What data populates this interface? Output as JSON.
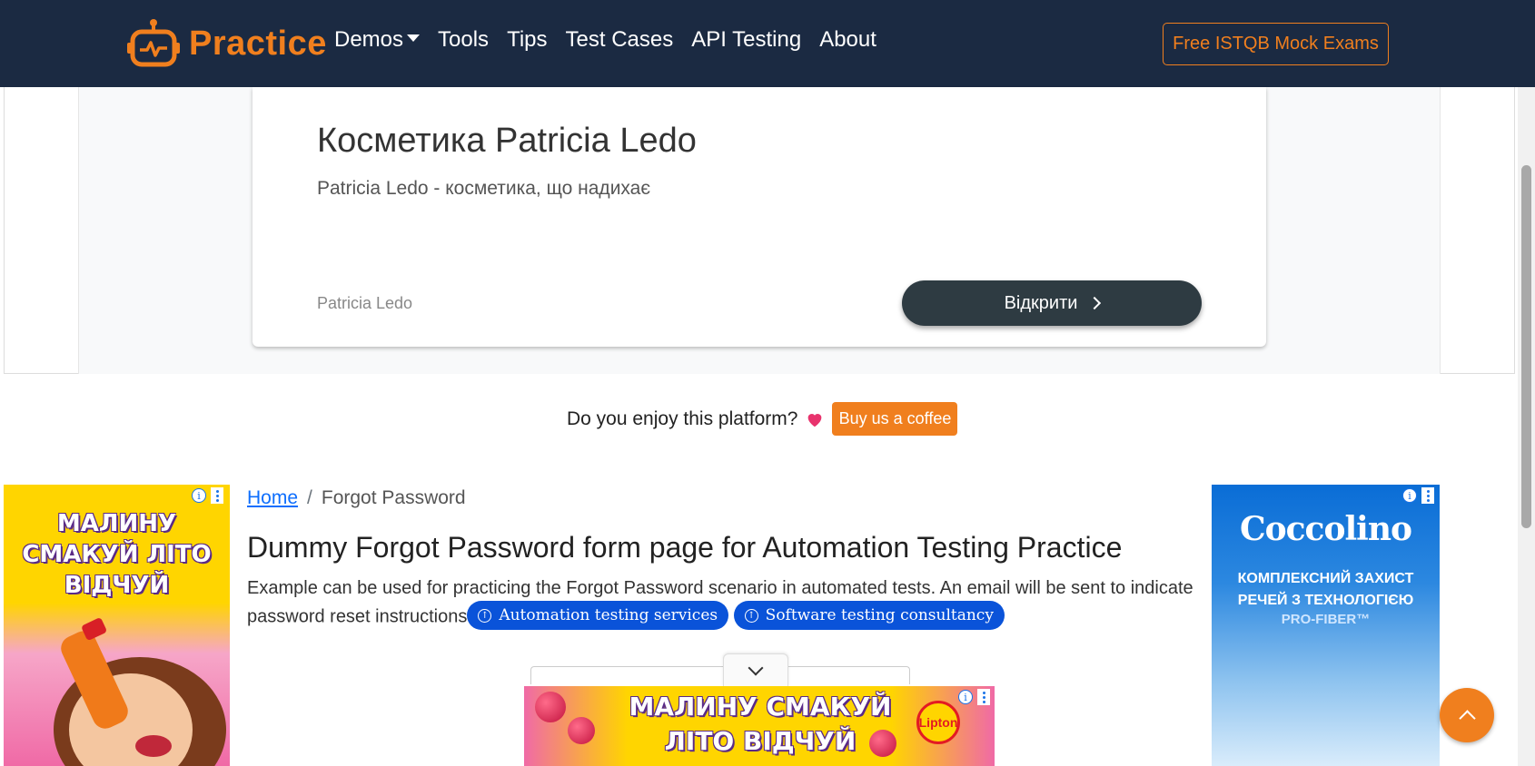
{
  "navbar": {
    "brand": "Practice",
    "links": [
      "Demos",
      "Tools",
      "Tips",
      "Test Cases",
      "API Testing",
      "About"
    ],
    "cta": "Free ISTQB Mock Exams",
    "bg_color": "#1b2a42",
    "accent_color": "#f07f1e"
  },
  "top_ad": {
    "title": "Косметика Patricia Ledo",
    "subtitle": "Patricia Ledo - косметика, що надихає",
    "brand": "Patricia Ledo",
    "button": "Відкрити"
  },
  "coffee": {
    "text": "Do you enjoy this platform?",
    "icon": "heart-icon",
    "button": "Buy us a coffee"
  },
  "left_ad": {
    "headline": "МАЛИНУ СМАКУЙ ЛІТО ВІДЧУЙ"
  },
  "right_ad": {
    "brand": "Coccolino",
    "tagline": "КОМПЛЕКСНИЙ ЗАХИСТ РЕЧЕЙ З ТЕХНОЛОГІЄЮ",
    "sub": "PRO-FIBER™"
  },
  "breadcrumb": {
    "home": "Home",
    "current": "Forgot Password"
  },
  "main": {
    "title": "Dummy Forgot Password form page for Automation Testing Practice",
    "description": "Example can be used for practicing the Forgot Password scenario in automated tests. An email will be sent to indicate password reset instructions",
    "chips": [
      "Automation testing services",
      "Software testing consultancy"
    ]
  },
  "bottom_ad": {
    "headline": "МАЛИНУ СМАКУЙ ЛІТО ВІДЧУЙ",
    "logo": "Lipton"
  }
}
